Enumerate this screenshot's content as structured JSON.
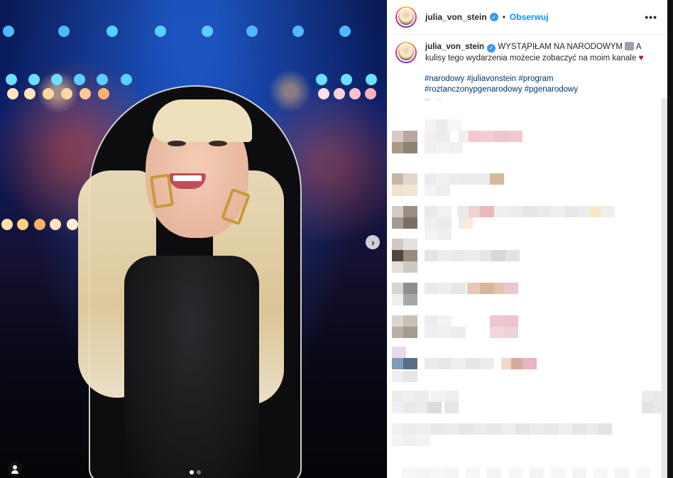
{
  "header": {
    "username": "julia_von_stein",
    "separator": "•",
    "follow_label": "Obserwuj",
    "more_label": "•••"
  },
  "caption": {
    "username": "julia_von_stein",
    "text": "WYSTĄPIŁAM NA NARODOWYM",
    "text_after_emoji": "A kulisy tego wydarzenia możecie zobaczyć na moim kanale",
    "hashtags": "#narodowy #juliavonstein #program #roztanczonypgenarodowy #pgenarodowy"
  },
  "carousel": {
    "next_icon": "chevron-right-icon",
    "slide_count": 2,
    "current_slide": 1
  },
  "colors": {
    "accent": "#0095f6",
    "hashtag": "#00376b",
    "verified": "#3897f0",
    "text": "#262626"
  }
}
